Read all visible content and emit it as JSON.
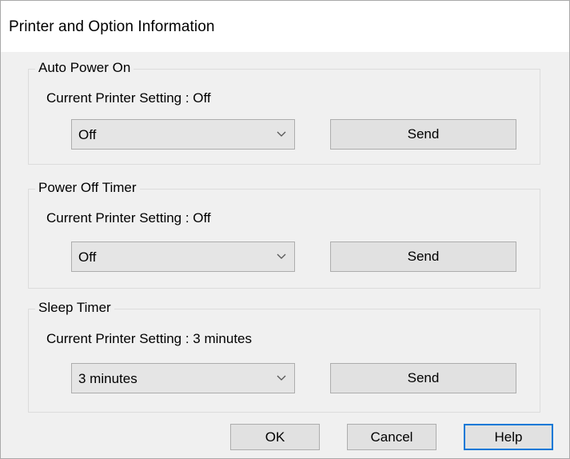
{
  "dialog": {
    "title": "Printer and Option Information"
  },
  "groups": [
    {
      "label": "Auto Power On",
      "setting_text": "Current Printer Setting : Off",
      "selected_value": "Off",
      "send_label": "Send"
    },
    {
      "label": "Power Off Timer",
      "setting_text": "Current Printer Setting : Off",
      "selected_value": "Off",
      "send_label": "Send"
    },
    {
      "label": "Sleep Timer",
      "setting_text": "Current Printer Setting : 3 minutes",
      "selected_value": "3 minutes",
      "send_label": "Send"
    }
  ],
  "footer": {
    "ok_label": "OK",
    "cancel_label": "Cancel",
    "help_label": "Help"
  },
  "icons": {
    "dropdown": "chevron-down-icon"
  },
  "colors": {
    "default_button_border": "#0078d7"
  }
}
